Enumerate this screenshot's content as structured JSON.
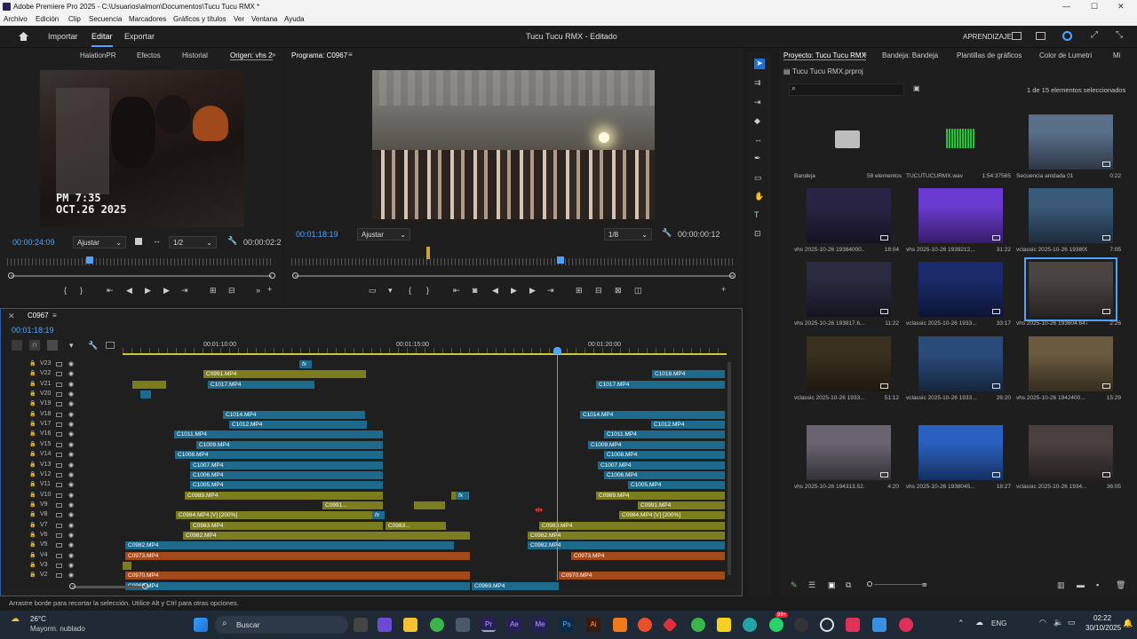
{
  "window": {
    "title": "Adobe Premiere Pro 2025 - C:\\Usuarios\\almon\\Documentos\\Tucu Tucu RMX *",
    "minimize": "—",
    "maximize": "☐",
    "close": "✕"
  },
  "menu": [
    "Archivo",
    "Edición",
    "Clip",
    "Secuencia",
    "Marcadores",
    "Gráficos y títulos",
    "Ver",
    "Ventana",
    "Ayuda"
  ],
  "header": {
    "import": "Importar",
    "edit": "Editar",
    "export": "Exportar",
    "project_title": "Tucu Tucu RMX - Editado",
    "learning": "APRENDIZAJE"
  },
  "source": {
    "tabs": [
      "HalationPR",
      "Efectos",
      "Historial",
      "Origen: vhs 2"
    ],
    "timecode": "00:00:24:09",
    "fit": "Ajustar",
    "res": "1/2",
    "duration": "00:00:02:2",
    "overlay_time": "PM 7:35",
    "overlay_date": "OCT.26 2025"
  },
  "program": {
    "tab": "Programa: C0967",
    "timecode": "00:01:18:19",
    "fit": "Ajustar",
    "res": "1/8",
    "duration": "00:00:00:12"
  },
  "timeline": {
    "tab": "C0967",
    "timecode": "00:01:18:19",
    "ticks": [
      "00:01:10:00",
      "00:01:15:00",
      "00:01:20:00"
    ],
    "tracks": [
      "V23",
      "V22",
      "V21",
      "V20",
      "V19",
      "V18",
      "V17",
      "V16",
      "V15",
      "V14",
      "V13",
      "V12",
      "V11",
      "V10",
      "V9",
      "V8",
      "V7",
      "V6",
      "V5",
      "V4",
      "V3",
      "V2"
    ],
    "clips": {
      "c1": "C0991.MP4",
      "c2": "C1017.MP4",
      "c3": "C1014.MP4",
      "c4": "C1012.MP4",
      "c5": "C1011.MP4",
      "c6": "C1009.MP4",
      "c7": "C1008.MP4",
      "c8": "C1007.MP4",
      "c9": "C1006.MP4",
      "c10": "C1005.MP4",
      "c11": "C0989.MP4",
      "c12": "C0991...",
      "c13": "C0984.MP4 [V] [200%]",
      "c14": "C0983.MP4",
      "c15": "C0983...",
      "c16": "C0982.MP4",
      "c17": "C0982.MP4",
      "c18": "C0973.MP4",
      "c19": "C0970.MP4",
      "c20": "C0969.MP4",
      "c21": "C0969.MP4",
      "c22": "C1018.MP4",
      "c23": "C1017.MP4",
      "c24": "C1014.MP4",
      "c25": "C1012.MP4",
      "c26": "C1011.MP4",
      "c27": "C1009.MP4",
      "c28": "C1008.MP4",
      "c29": "C1007.MP4",
      "c30": "C1006.MP4",
      "c31": "C1005.MP4",
      "c32": "C0989.MP4",
      "c33": "C0991.MP4",
      "c34": "C0984.MP4 [V] [200%]",
      "c35": "C0983.MP4",
      "c36": "C0982.MP4",
      "c37": "C0982.MP4",
      "c38": "C0973.MP4",
      "c39": "C0970.MP4",
      "fx": "fx"
    }
  },
  "project": {
    "tabs": [
      "Proyecto: Tucu Tucu RMX",
      "Bandeja: Bandeja",
      "Plantillas de gráficos",
      "Color de Lumetri",
      "Mi"
    ],
    "file": "Tucu Tucu RMX.prproj",
    "selection": "1 de 15 elementos seleccionados",
    "items": [
      {
        "name": "Bandeja",
        "info": "58 elementos"
      },
      {
        "name": "TUCUTUCURMX.wav",
        "info": "1:54:37565"
      },
      {
        "name": "Secuencia anidada 01",
        "info": "0:22"
      },
      {
        "name": "vhs 2025-10-26 19384000...",
        "info": "18:04"
      },
      {
        "name": "vhs 2025-10-26 1939212...",
        "info": "31:22"
      },
      {
        "name": "vclassic 2025-10-26 193809...",
        "info": "7:05"
      },
      {
        "name": "vhs 2025-10-26 193817.6...",
        "info": "11:22"
      },
      {
        "name": "vclassic 2025-10-26 1933...",
        "info": "33:17"
      },
      {
        "name": "vhs 2025-10-26 193604.647...",
        "info": "2:26"
      },
      {
        "name": "vclassic 2025-10-26 1933...",
        "info": "51:12"
      },
      {
        "name": "vclassic 2025-10-26 1933...",
        "info": "26:20"
      },
      {
        "name": "vhs 2025-10-26 1942400...",
        "info": "15:29"
      },
      {
        "name": "vhs 2025-10-26 194313.52...",
        "info": "4:20"
      },
      {
        "name": "vhs 2025-10-26 1938045...",
        "info": "18:27"
      },
      {
        "name": "vclassic 2025-10-26 1934...",
        "info": "36:05"
      }
    ]
  },
  "status": "Arrastre borde para recortar la selección. Utilice Alt y Ctrl para otras opciones.",
  "taskbar": {
    "temp": "26°C",
    "weather": "Mayorm. nublado",
    "search": "Buscar",
    "lang": "ENG",
    "time": "02:22",
    "date": "30/10/2025",
    "badge": "99+"
  }
}
